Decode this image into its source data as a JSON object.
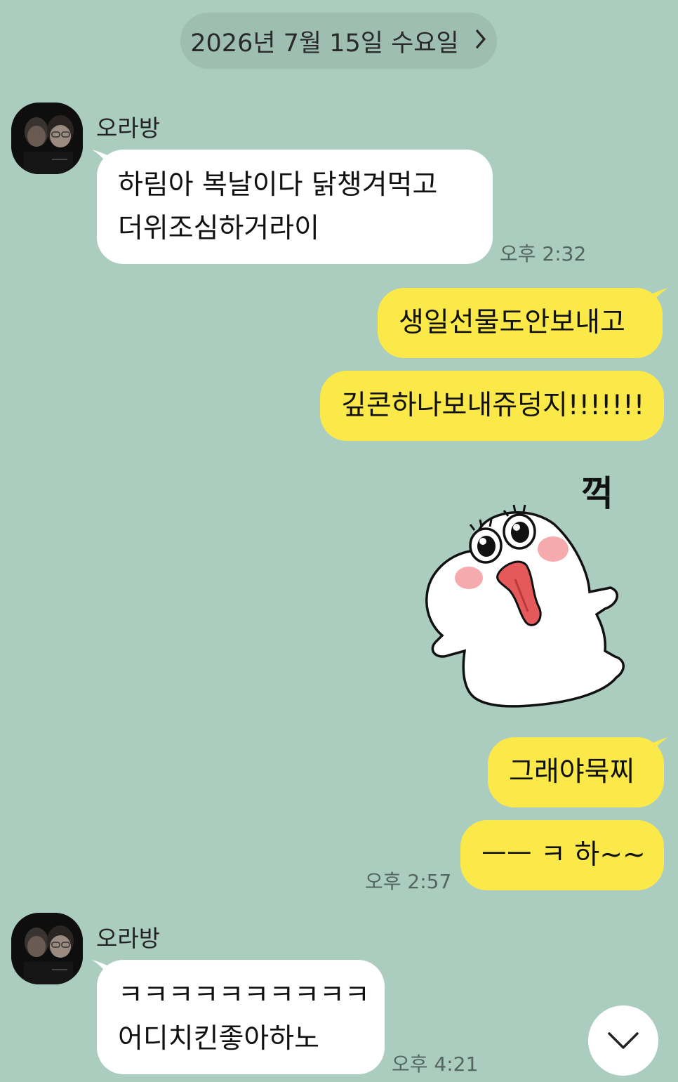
{
  "date_header": {
    "label": "2026년 7월 15일 수요일",
    "chevron_icon": "chevron-right-icon"
  },
  "colors": {
    "background": "#abcdc0",
    "incoming_bubble": "#ffffff",
    "outgoing_bubble": "#fbe94a"
  },
  "messages": [
    {
      "type": "incoming",
      "sender": "오라방",
      "lines": [
        "하림아 복날이다 닭챙겨먹고",
        "더위조심하거라이"
      ],
      "time": "오후 2:32"
    },
    {
      "type": "outgoing",
      "lines": [
        "생일선물도안보내고"
      ]
    },
    {
      "type": "outgoing",
      "lines": [
        "깊콘하나보내쥬덩지!!!!!!!"
      ]
    },
    {
      "type": "sticker",
      "sticker_text": "꺽",
      "icon": "ghost-sticker-icon"
    },
    {
      "type": "outgoing",
      "lines": [
        "그래야묵찌"
      ]
    },
    {
      "type": "outgoing",
      "lines": [
        "ㅡㅡ ㅋ 하~~"
      ],
      "time": "오후 2:57"
    },
    {
      "type": "incoming",
      "sender": "오라방",
      "lines": [
        "ㅋㅋㅋㅋㅋㅋㅋㅋㅋㅋ",
        "어디치킨좋아하노"
      ],
      "time": "오후 4:21"
    }
  ],
  "scroll_down_icon": "chevron-down-icon"
}
